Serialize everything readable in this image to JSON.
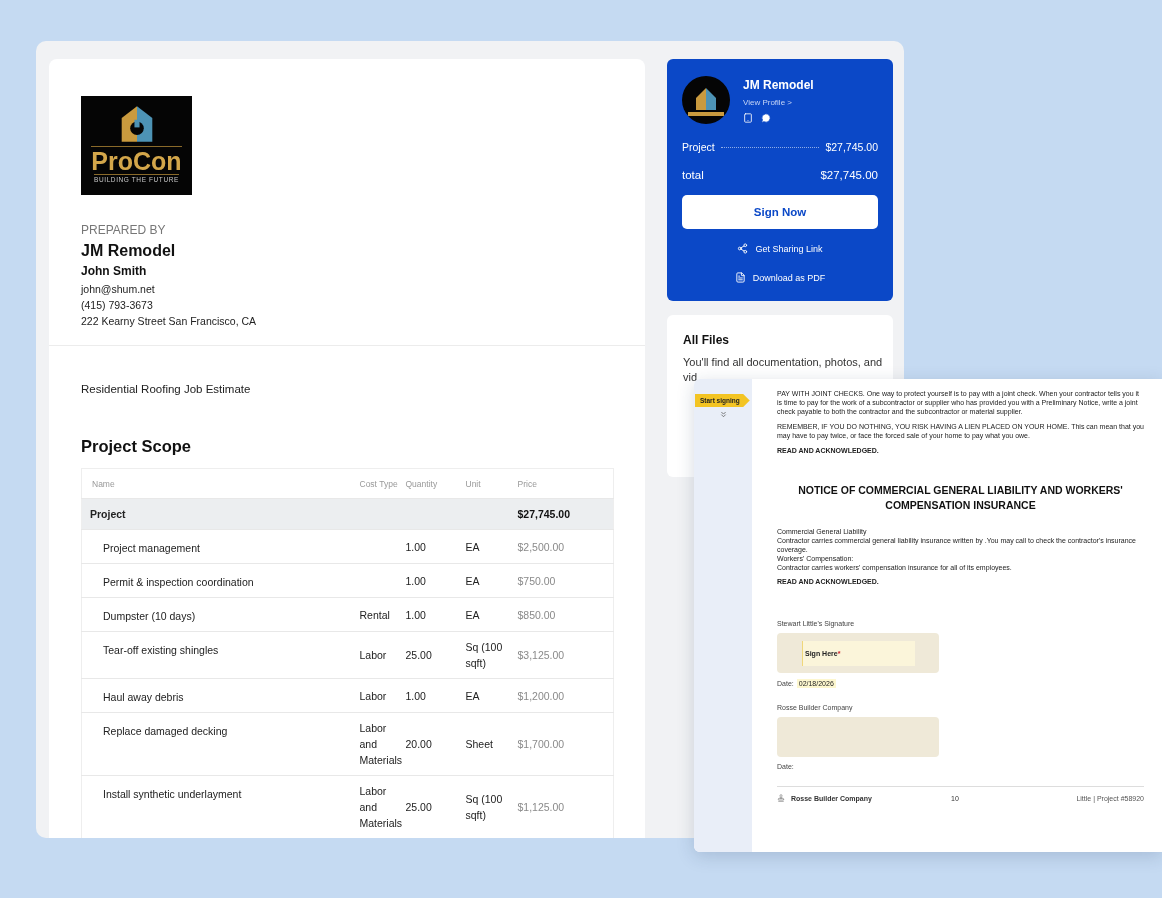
{
  "logo": {
    "name": "ProCon",
    "tagline": "BUILDING THE FUTURE"
  },
  "prepared_by": {
    "label": "PREPARED BY",
    "company": "JM Remodel",
    "person": "John Smith",
    "email": "john@shum.net",
    "phone": "(415) 793-3673",
    "address": "222 Kearny Street San Francisco, CA"
  },
  "estimate_title": "Residential Roofing Job Estimate",
  "scope": {
    "title": "Project Scope",
    "columns": [
      "Name",
      "Cost Type",
      "Quantity",
      "Unit",
      "Price"
    ],
    "rows": [
      {
        "kind": "group",
        "name": "Project",
        "price": "$27,745.00"
      },
      {
        "kind": "item",
        "name": "Project management",
        "quantity": "1.00",
        "unit": "EA",
        "price": "$2,500.00"
      },
      {
        "kind": "item",
        "name": "Permit & inspection coordination",
        "quantity": "1.00",
        "unit": "EA",
        "price": "$750.00"
      },
      {
        "kind": "item",
        "name": "Dumpster (10 days)",
        "cost_type": "Rental",
        "quantity": "1.00",
        "unit": "EA",
        "price": "$850.00"
      },
      {
        "kind": "item",
        "name": "Tear-off existing shingles",
        "cost_type": "Labor",
        "quantity": "25.00",
        "unit": "Sq (100 sqft)",
        "price": "$3,125.00"
      },
      {
        "kind": "item",
        "name": "Haul away debris",
        "cost_type": "Labor",
        "quantity": "1.00",
        "unit": "EA",
        "price": "$1,200.00"
      },
      {
        "kind": "item",
        "name": "Replace damaged decking",
        "cost_type": "Labor and Materials",
        "quantity": "20.00",
        "unit": "Sheet",
        "price": "$1,700.00"
      },
      {
        "kind": "item",
        "name": "Install synthetic underlayment",
        "cost_type": "Labor and Materials",
        "quantity": "25.00",
        "unit": "Sq (100 sqft)",
        "price": "$1,125.00"
      }
    ]
  },
  "summary": {
    "company": "JM Remodel",
    "profile_link": "View Profile >",
    "lines": [
      {
        "kind": "leader",
        "label": "Project",
        "amount": "$27,745.00"
      },
      {
        "kind": "total",
        "label": "total",
        "amount": "$27,745.00"
      }
    ],
    "primary_button": "Sign Now",
    "actions": [
      {
        "kind": "share",
        "label": "Get Sharing Link"
      },
      {
        "kind": "pdf",
        "label": "Download as PDF"
      }
    ]
  },
  "files": {
    "title": "All Files",
    "description": "You'll find all documentation, photos, and vid"
  },
  "document": {
    "start_signing": "Start signing",
    "paragraphs": [
      {
        "kind": "text",
        "text": "PAY WITH JOINT CHECKS. One way to protect yourself is to pay with a joint check. When your contractor tells you it is time to pay for the work of a subcontractor or supplier who has provided you with a Preliminary Notice, write a joint check payable to both the contractor and the subcontractor or material supplier."
      },
      {
        "kind": "text",
        "text": "REMEMBER, IF YOU DO NOTHING, YOU RISK HAVING A LIEN PLACED ON YOUR HOME. This can mean that you may have to pay twice, or face the forced sale of your home to pay what you owe."
      },
      {
        "kind": "strong",
        "text": "READ AND ACKNOWLEDGED."
      }
    ],
    "notice_title": "NOTICE OF COMMERCIAL GENERAL LIABILITY AND WORKERS' COMPENSATION INSURANCE",
    "notice_lines": [
      {
        "kind": "text",
        "text": "Commercial General Liability"
      },
      {
        "kind": "text",
        "text": "Contractor carries commercial general liability insurance written by   .You may call    to check the contractor's insurance coverage."
      },
      {
        "kind": "text",
        "text": "Workers' Compensation:"
      },
      {
        "kind": "text",
        "text": "Contractor carries workers' compensation insurance for all of its employees."
      },
      {
        "kind": "strong",
        "text": "READ AND ACKNOWLEDGED."
      }
    ],
    "signatures": [
      {
        "label": "Stewart Little's Signature",
        "placeholder": "Sign Here",
        "required_mark": "*",
        "date_label": "Date:",
        "date": "02/18/2026"
      },
      {
        "label": "Rosse Builder Company",
        "date_label": "Date:"
      }
    ],
    "footer": {
      "company": "Rosse Builder Company",
      "page": "10",
      "project": "Little | Project #58920"
    }
  }
}
